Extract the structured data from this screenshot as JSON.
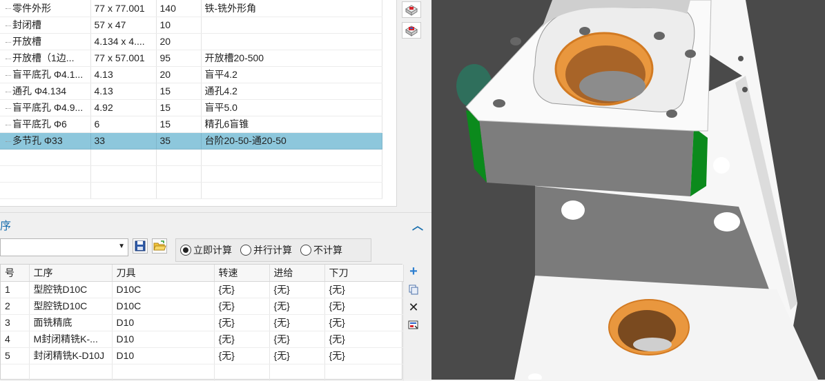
{
  "features": {
    "rows": [
      [
        "零件外形",
        "77 x 77.001",
        "140",
        "铁-铣外形角"
      ],
      [
        "封闭槽",
        "57 x 47",
        "10",
        ""
      ],
      [
        "开放槽",
        "4.134 x 4....",
        "20",
        ""
      ],
      [
        "开放槽（1边...",
        "77 x 57.001",
        "95",
        "开放槽20-500"
      ],
      [
        "盲平底孔 Φ4.1...",
        "4.13",
        "20",
        "盲平4.2"
      ],
      [
        "通孔 Φ4.134",
        "4.13",
        "15",
        "通孔4.2"
      ],
      [
        "盲平底孔 Φ4.9...",
        "4.92",
        "15",
        "盲平5.0"
      ],
      [
        "盲平底孔 Φ6",
        "6",
        "15",
        "精孔6盲锥"
      ],
      [
        "多节孔 Φ33",
        "33",
        "35",
        "台阶20-50-通20-50"
      ]
    ],
    "selected_row": 8
  },
  "process_panel": {
    "title": "序",
    "combo_value": "",
    "radios": [
      {
        "label": "立即计算",
        "checked": true
      },
      {
        "label": "并行计算",
        "checked": false
      },
      {
        "label": "不计算",
        "checked": false
      }
    ]
  },
  "operations": {
    "headers": [
      "号",
      "工序",
      "刀具",
      "转速",
      "进给",
      "下刀"
    ],
    "rows": [
      [
        "1",
        "型腔铣D10C",
        "D10C",
        "{无}",
        "{无}",
        "{无}"
      ],
      [
        "2",
        "型腔铣D10C",
        "D10C",
        "{无}",
        "{无}",
        "{无}"
      ],
      [
        "3",
        "面铣精底",
        "D10",
        "{无}",
        "{无}",
        "{无}"
      ],
      [
        "4",
        "M封闭精铣K-...",
        "D10",
        "{无}",
        "{无}",
        "{无}"
      ],
      [
        "5",
        "封闭精铣K-D10J",
        "D10",
        "{无}",
        "{无}",
        "{无}"
      ]
    ]
  },
  "icons": {
    "side": [
      "feature-view-icon",
      "feature-edit-icon"
    ],
    "toolbar": [
      "save-icon",
      "open-folder-icon"
    ],
    "op_side": [
      "add-icon",
      "copy-icon",
      "delete-icon",
      "export-icon"
    ],
    "collapse": "chevron-up-icon",
    "combo_arrow": "dropdown-arrow-icon"
  },
  "colors": {
    "selection": "#8dc7dc",
    "accent": "#1a6fae",
    "model_orange": "#e28f3a",
    "model_green": "#0b8a1c"
  }
}
